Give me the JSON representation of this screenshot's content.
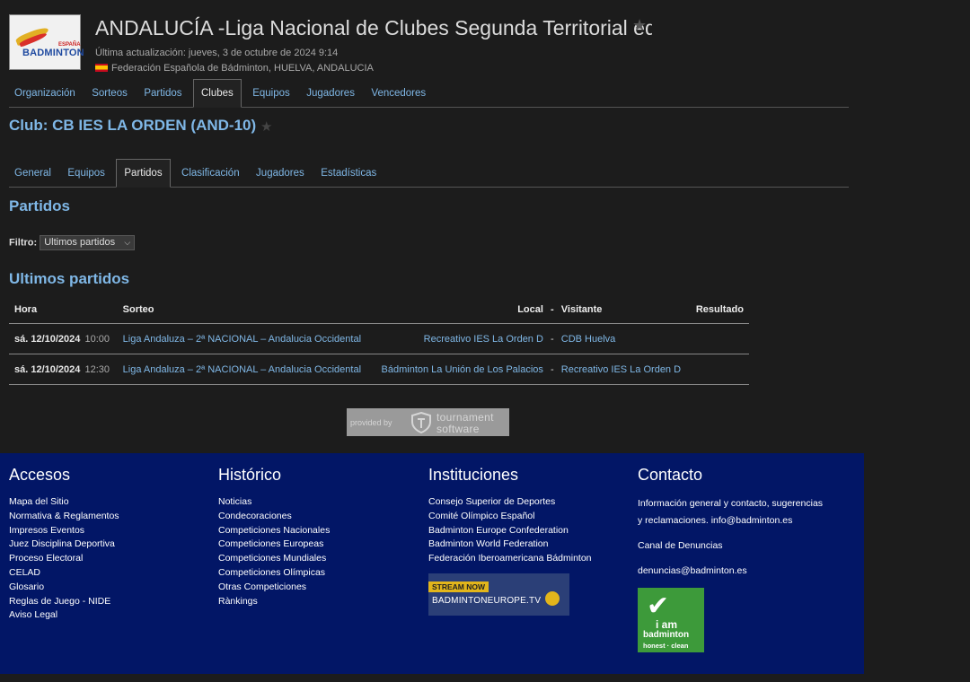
{
  "header": {
    "title": "ANDALUCÍA -Liga Nacional de Clubes Segunda Territorial ed",
    "updated": "Última actualización: jueves, 3 de octubre de 2024 9:14",
    "federation": "Federación Española de Bádminton, HUELVA, ANDALUCIA",
    "logo_text_top": "ESPAÑA",
    "logo_text": "BADMINTON"
  },
  "main_tabs": [
    {
      "label": "Organización"
    },
    {
      "label": "Sorteos"
    },
    {
      "label": "Partidos"
    },
    {
      "label": "Clubes",
      "active": true
    },
    {
      "label": "Equipos"
    },
    {
      "label": "Jugadores"
    },
    {
      "label": "Vencedores"
    }
  ],
  "club": {
    "title": "Club: CB IES LA ORDEN (AND-10)"
  },
  "club_tabs": [
    {
      "label": "General"
    },
    {
      "label": "Equipos"
    },
    {
      "label": "Partidos",
      "active": true
    },
    {
      "label": "Clasificación"
    },
    {
      "label": "Jugadores"
    },
    {
      "label": "Estadísticas"
    }
  ],
  "section": {
    "title": "Partidos",
    "filter_label": "Filtro:",
    "filter_value": "Ultimos partidos",
    "subtitle": "Ultimos partidos"
  },
  "table": {
    "headers": {
      "hora": "Hora",
      "sorteo": "Sorteo",
      "local": "Local",
      "dash": "-",
      "visitante": "Visitante",
      "resultado": "Resultado"
    },
    "rows": [
      {
        "date": "sá. 12/10/2024",
        "time": "10:00",
        "draw": "Liga Andaluza – 2ª NACIONAL – Andalucia Occidental",
        "local": "Recreativo IES La Orden D",
        "visitor": "CDB Huelva",
        "result": ""
      },
      {
        "date": "sá. 12/10/2024",
        "time": "12:30",
        "draw": "Liga Andaluza – 2ª NACIONAL – Andalucia Occidental",
        "local": "Bádminton La Unión de Los Palacios",
        "visitor": "Recreativo IES La Orden D",
        "result": ""
      }
    ]
  },
  "provider": {
    "prefix": "provided by",
    "line1": "tournament",
    "line2": "software"
  },
  "footer": {
    "accesos": {
      "title": "Accesos",
      "items": [
        "Mapa del Sitio",
        "Normativa & Reglamentos",
        "Impresos Eventos",
        "Juez Disciplina Deportiva",
        "Proceso Electoral",
        "CELAD",
        "Glosario",
        "Reglas de Juego - NIDE",
        "Aviso Legal"
      ]
    },
    "historico": {
      "title": "Histórico",
      "items": [
        "Noticias",
        "Condecoraciones",
        "Competiciones Nacionales",
        "Competiciones Europeas",
        "Competiciones Mundiales",
        "Competiciones Olímpicas",
        "Otras Competiciones",
        "Rànkings"
      ]
    },
    "instituciones": {
      "title": "Instituciones",
      "items": [
        "Consejo Superior de Deportes",
        "Comité Olímpico Español",
        "Badminton Europe Confederation",
        "Badminton World Federation",
        "Federación Iberoamericana Bádminton"
      ],
      "stream_label": "STREAM NOW",
      "stream_site": "BADMINTONEUROPE.TV"
    },
    "contacto": {
      "title": "Contacto",
      "info_line1": "Información general y contacto, sugerencias",
      "info_line2": "y reclamaciones. info@badminton.es",
      "denuncias_title": "Canal de Denuncias",
      "denuncias_email": "denuncias@badminton.es",
      "badge_line1": "i am",
      "badge_line2": "badminton",
      "badge_line3": "honest · clean"
    }
  },
  "colors": {
    "link": "#7fb7e6",
    "footer_bg": "#021666",
    "background": "#1c1c1c"
  }
}
